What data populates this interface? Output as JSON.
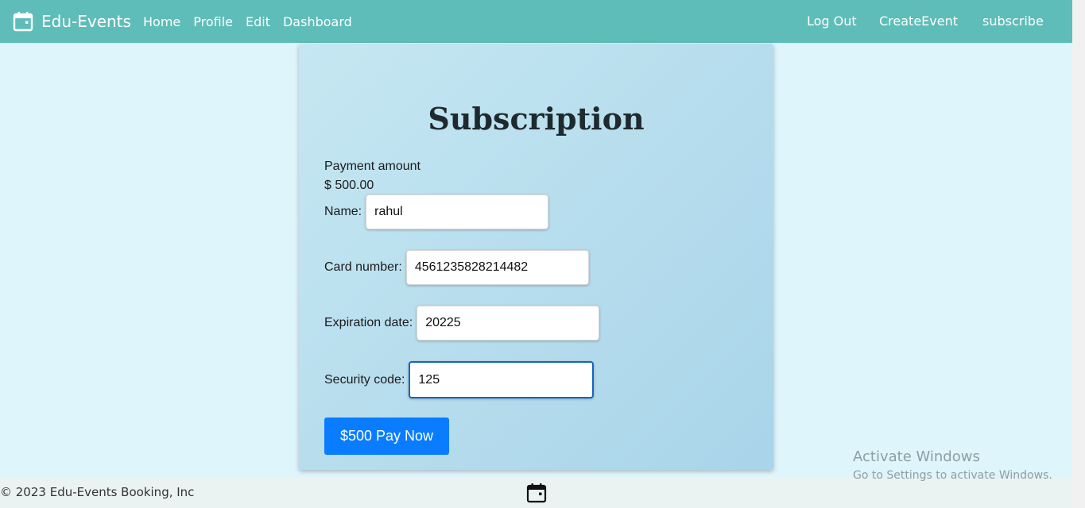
{
  "navbar": {
    "brand": "Edu-Events",
    "left_links": [
      "Home",
      "Profile",
      "Edit",
      "Dashboard"
    ],
    "right_links": [
      "Log Out",
      "CreateEvent",
      "subscribe"
    ],
    "color": "#5ebdb8"
  },
  "subscription": {
    "title": "Subscription",
    "payment_amount_label": "Payment amount",
    "payment_amount": "$ 500.00",
    "fields": {
      "name": {
        "label": "Name:",
        "value": "rahul"
      },
      "card_number": {
        "label": "Card number:",
        "value": "4561235828214482"
      },
      "expiration_date": {
        "label": "Expiration date:",
        "value": "20225"
      },
      "security_code": {
        "label": "Security code:",
        "value": "125"
      }
    },
    "pay_button": "$500 Pay Now",
    "button_color": "#0a7cff"
  },
  "footer": {
    "text": "© 2023 Edu-Events Booking, Inc"
  },
  "watermark": {
    "title": "Activate Windows",
    "subtitle": "Go to Settings to activate Windows."
  },
  "icons": {
    "brand": "calendar-icon",
    "footer": "calendar-icon"
  }
}
